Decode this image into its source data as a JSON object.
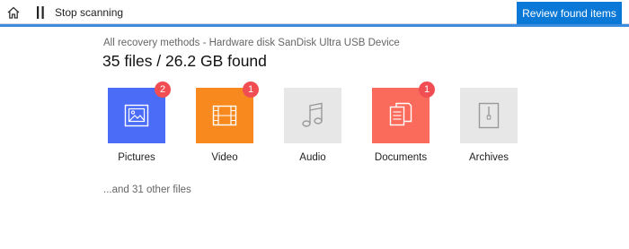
{
  "toolbar": {
    "stop_label": "Stop scanning",
    "review_label": "Review found items",
    "accent": "#0a78d7"
  },
  "summary": {
    "subtitle": "All recovery methods - Hardware disk SanDisk Ultra USB Device",
    "headline": "35 files / 26.2 GB found"
  },
  "categories": [
    {
      "label": "Pictures",
      "badge": "2",
      "icon": "image-icon",
      "color": "#4b6cf6"
    },
    {
      "label": "Video",
      "badge": "1",
      "icon": "film-icon",
      "color": "#f7891f"
    },
    {
      "label": "Audio",
      "badge": "",
      "icon": "music-note-icon",
      "color": "#e7e7e7"
    },
    {
      "label": "Documents",
      "badge": "1",
      "icon": "documents-icon",
      "color": "#fb6b5b"
    },
    {
      "label": "Archives",
      "badge": "",
      "icon": "archive-icon",
      "color": "#e7e7e7"
    }
  ],
  "footer": {
    "other_files": "...and 31 other files"
  }
}
